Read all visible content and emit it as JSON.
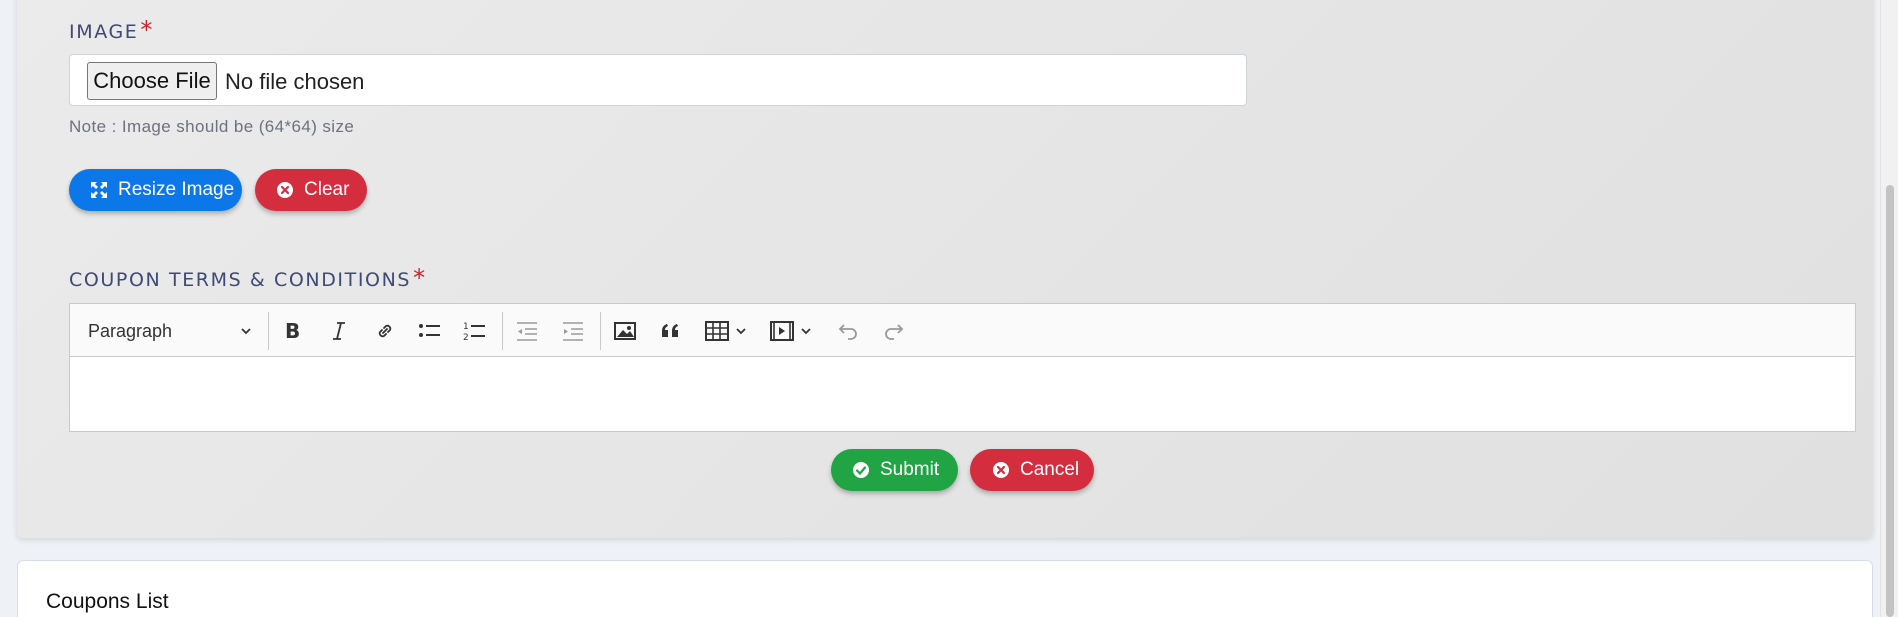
{
  "image_section": {
    "label": "IMAGE",
    "required_mark": "*",
    "file_button_label": "Choose File",
    "file_status": "No file chosen",
    "note": "Note : Image should be (64*64) size",
    "resize_button_label": "Resize Image",
    "clear_button_label": "Clear"
  },
  "terms_section": {
    "label": "COUPON TERMS & CONDITIONS",
    "required_mark": "*",
    "editor": {
      "block_format": "Paragraph",
      "tools": [
        "bold-icon",
        "italic-icon",
        "link-icon",
        "bulleted-list-icon",
        "numbered-list-icon",
        "outdent-icon",
        "indent-icon",
        "image-icon",
        "blockquote-icon",
        "table-icon",
        "media-icon",
        "undo-icon",
        "redo-icon"
      ],
      "content": ""
    }
  },
  "actions": {
    "submit_label": "Submit",
    "cancel_label": "Cancel"
  },
  "coupons_list": {
    "title": "Coupons List"
  },
  "colors": {
    "primary": "#0b77e8",
    "danger": "#d42e3e",
    "success": "#20a444",
    "label": "#3d4a75"
  }
}
